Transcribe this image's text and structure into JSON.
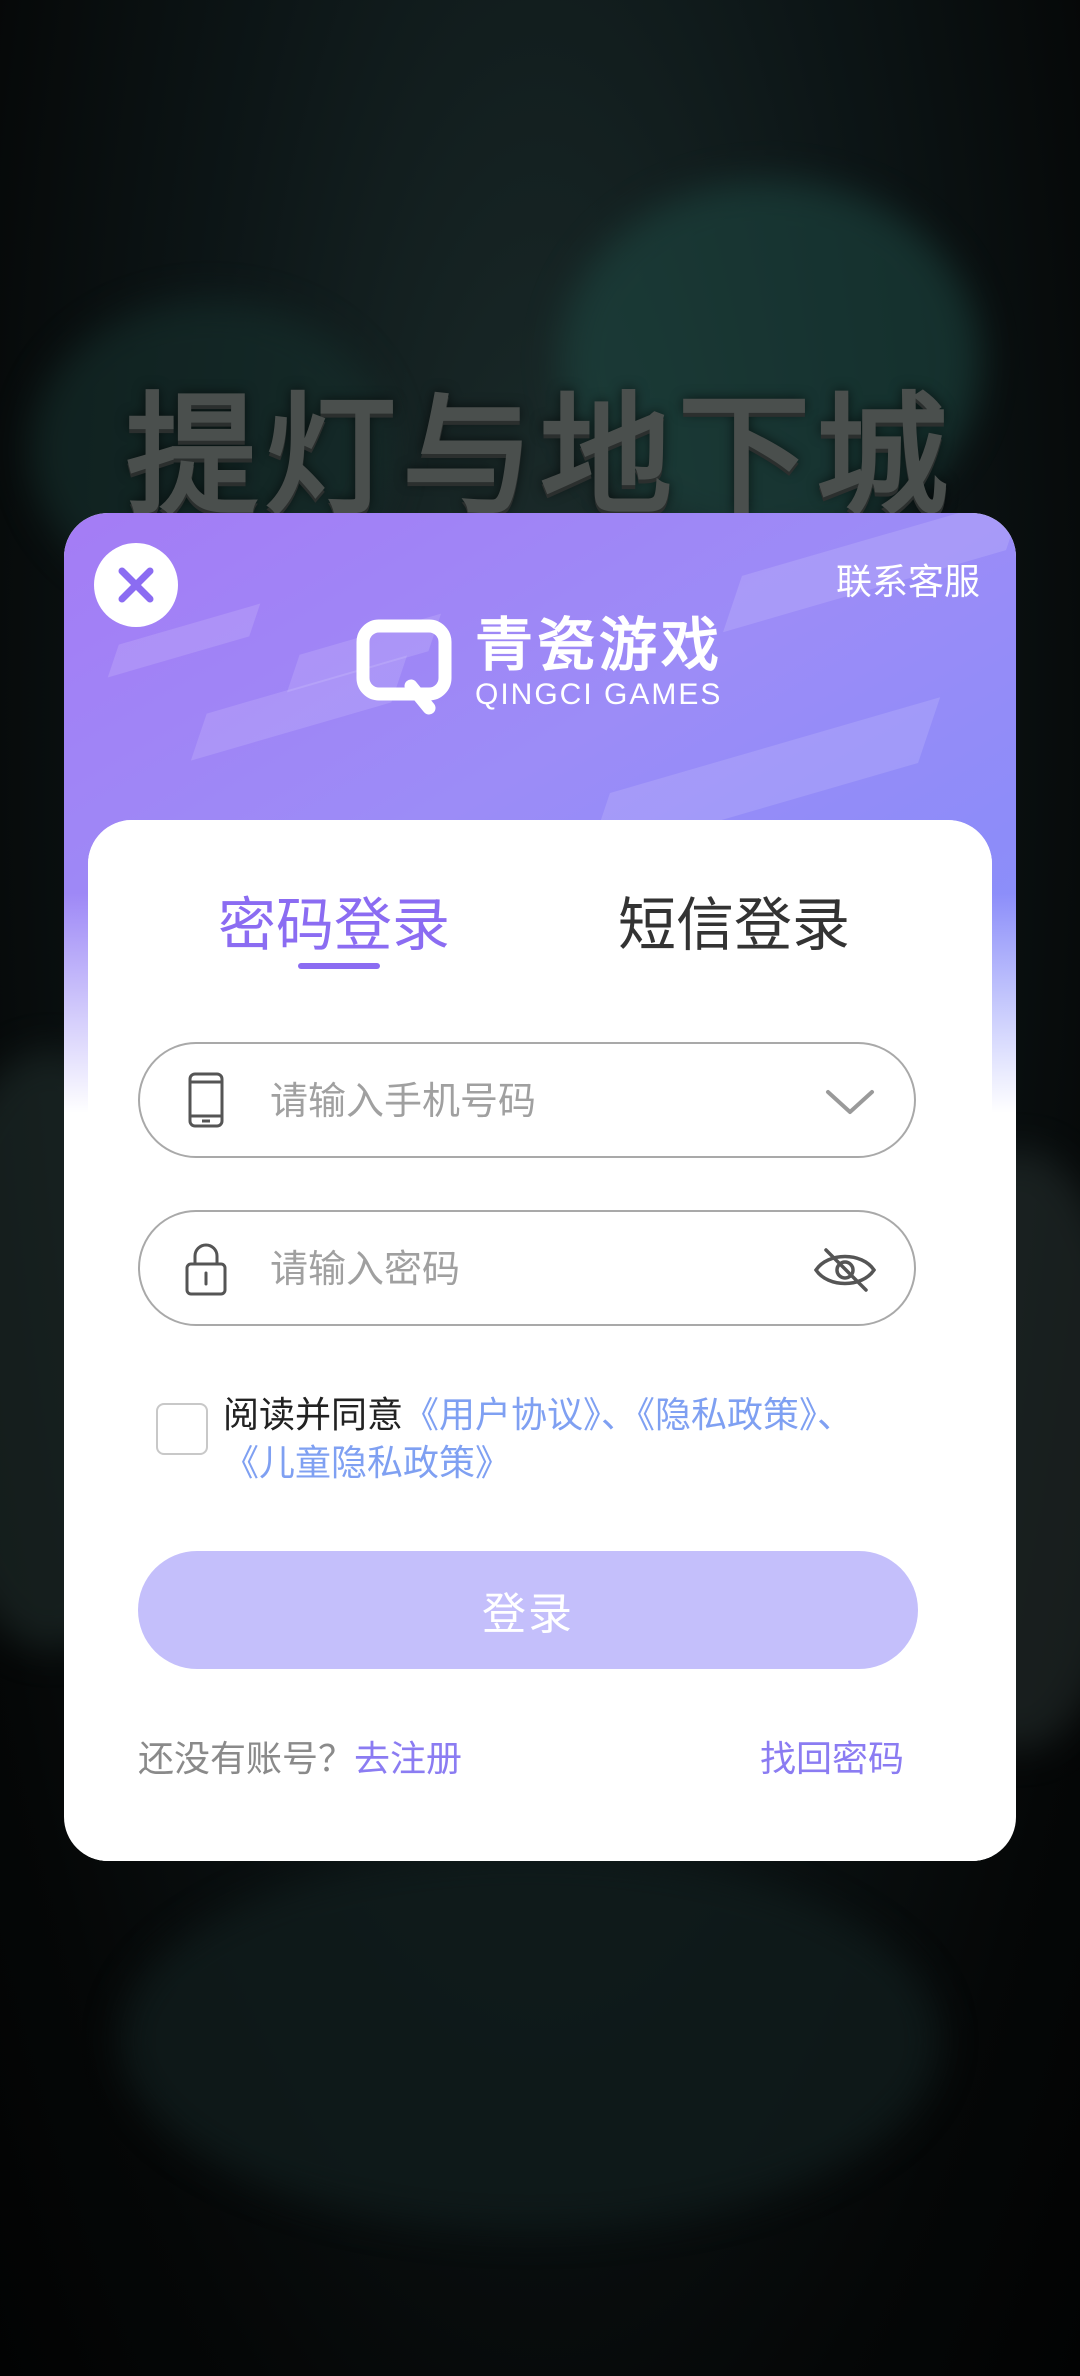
{
  "background": {
    "game_title": "提灯与地下城"
  },
  "dialog": {
    "close_icon": "close-x-icon",
    "support_label": "联系客服",
    "logo": {
      "name_cn": "青瓷游戏",
      "name_en": "QINGCI GAMES"
    },
    "tabs": [
      {
        "label": "密码登录",
        "active": true
      },
      {
        "label": "短信登录",
        "active": false
      }
    ],
    "phone_field": {
      "placeholder": "请输入手机号码",
      "value": "",
      "icon": "phone-icon",
      "trail_icon": "chevron-down-icon"
    },
    "password_field": {
      "placeholder": "请输入密码",
      "value": "",
      "icon": "lock-icon",
      "trail_icon": "eye-off-icon"
    },
    "agreement": {
      "checked": false,
      "prefix": "阅读并同意",
      "user_agreement": "《用户协议》",
      "sep1": "、",
      "privacy_policy": "《隐私政策》",
      "sep2": "、",
      "child_privacy": "《儿童隐私政策》"
    },
    "login_button": "登录",
    "register_prompt": "还没有账号？",
    "register_link": "去注册",
    "forgot_password": "找回密码"
  },
  "colors": {
    "accent": "#8b6cf2",
    "link_blue": "#7fa0f2",
    "login_button_disabled": "#c4bffb"
  }
}
